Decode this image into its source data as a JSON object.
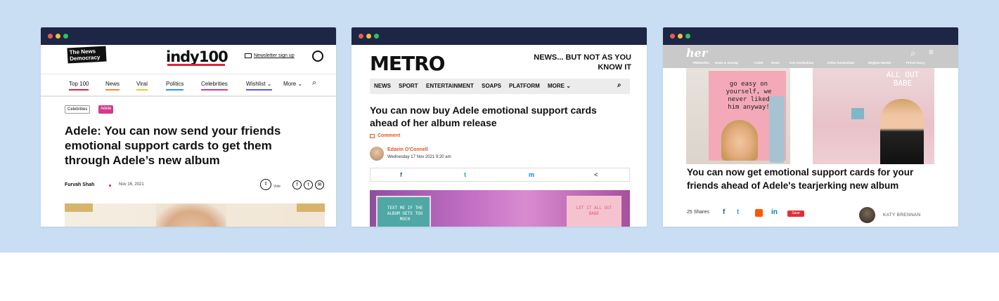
{
  "colors": {
    "backdrop": "#c9def3",
    "window_bar": "#1d2645",
    "indy_accent": "#e2233a",
    "metro_accent": "#e5541b",
    "her_header": "#c9c9c9"
  },
  "windows": [
    {
      "site": "indy100",
      "brand_badge": "The News Democracy",
      "logo": "indy100",
      "newsletter_label": "Newsletter sign up",
      "nav": [
        "Top 100",
        "News",
        "Viral",
        "Politics",
        "Celebrities",
        "Wishlist",
        "More"
      ],
      "tags": [
        "Celebrities",
        "Adele"
      ],
      "headline": "Adele: You can now send your friends emotional support cards to get them through Adele’s new album",
      "author": "Furvah Shah",
      "date": "Nov 16, 2021",
      "vote_label": "Vote"
    },
    {
      "site": "Metro",
      "logo": "METRO",
      "tagline": "NEWS... BUT NOT AS YOU KNOW IT",
      "nav": [
        "NEWS",
        "SPORT",
        "ENTERTAINMENT",
        "SOAPS",
        "PLATFORM",
        "MORE ⌄"
      ],
      "headline": "You can now buy Adele emotional support cards ahead of her album release",
      "comment_label": "Comment",
      "author": "Edaein O'Connell",
      "date": "Wednesday 17 Nov 2021 9:20 am",
      "share": [
        "f",
        "t",
        "m",
        "<"
      ],
      "card_left_text": "TEXT ME IF THE ALBUM GETS TOO MUCH",
      "card_right_text": "LET IT ALL OUT BABE"
    },
    {
      "site": "her",
      "logo": "her",
      "trending_label": "TRENDING:",
      "trending": [
        "News & Gossip",
        "Celeb",
        "News",
        "Kim Kardashian",
        "Khloe Kardashian",
        "Meghan Markle",
        "Prince Harry"
      ],
      "card1_text": "go easy on yourself, we never liked him anyway!",
      "card2_text": "ALL OUT BABE",
      "headline": "You can now get emotional support cards for your friends ahead of Adele's tearjerking new album",
      "shares": "25 Shares",
      "save_label": "Save",
      "author": "KATY BRENNAN"
    }
  ]
}
